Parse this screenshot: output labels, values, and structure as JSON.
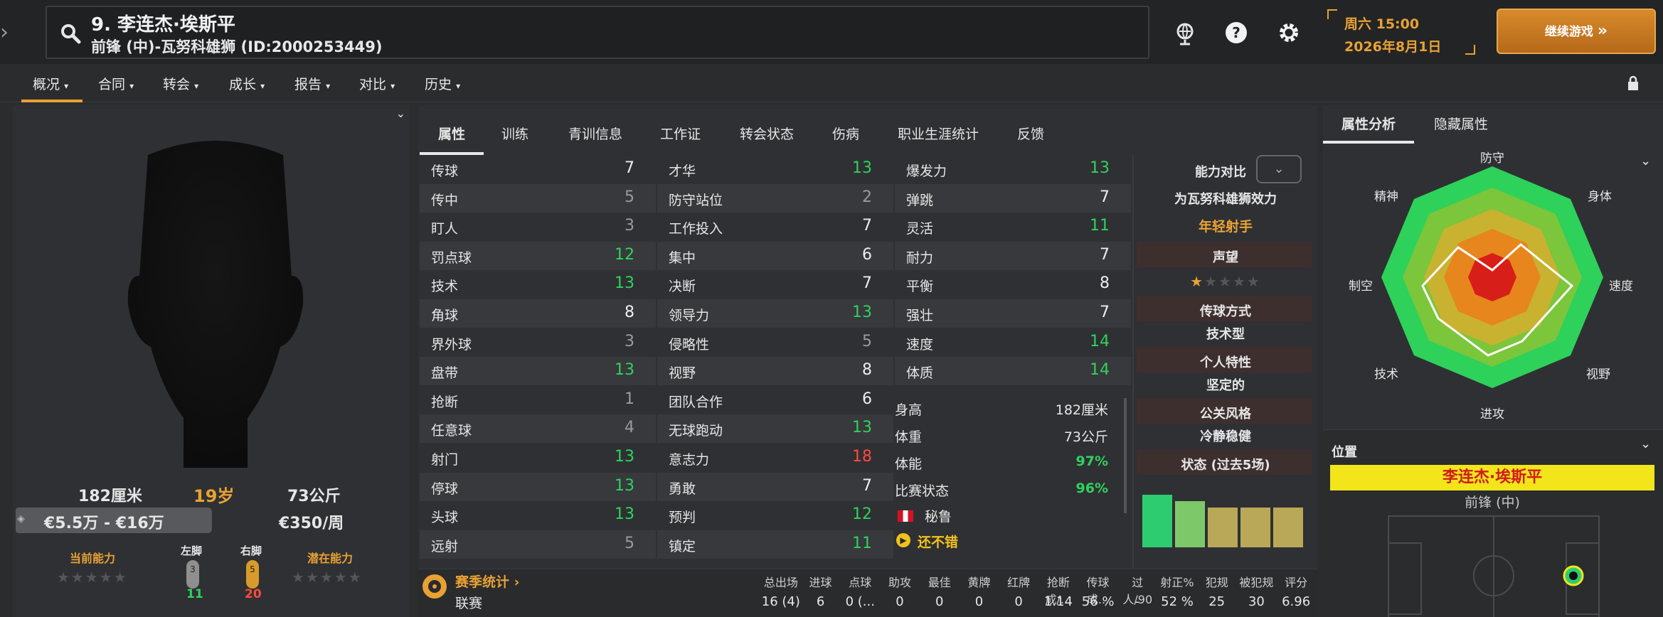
{
  "header": {
    "player_name": "9. 李连杰·埃斯平",
    "player_subtitle": "前锋 (中)-瓦努科雄狮 (ID:2000253449)",
    "date_weekday": "周六 15:00",
    "date_full": "2026年8月1日",
    "continue_label": "继续游戏"
  },
  "nav": {
    "items": [
      {
        "label": "概况"
      },
      {
        "label": "合同"
      },
      {
        "label": "转会"
      },
      {
        "label": "成长"
      },
      {
        "label": "报告"
      },
      {
        "label": "对比"
      },
      {
        "label": "历史"
      }
    ]
  },
  "player": {
    "height": "182厘米",
    "age": "19岁",
    "weight": "73公斤",
    "value": "€5.5万 - €16万",
    "wage": "€350/周",
    "current_ability_label": "当前能力",
    "potential_ability_label": "潜在能力",
    "left_foot_label": "左脚",
    "right_foot_label": "右脚",
    "left_foot_level": "3",
    "right_foot_level": "5",
    "left_foot_value": "11",
    "right_foot_value": "20"
  },
  "tabs": [
    "属性",
    "训练",
    "青训信息",
    "工作证",
    "转会状态",
    "伤病",
    "职业生涯统计",
    "反馈"
  ],
  "attributes": {
    "technical": [
      {
        "name": "传球",
        "value": "7"
      },
      {
        "name": "传中",
        "value": "5"
      },
      {
        "name": "盯人",
        "value": "3"
      },
      {
        "name": "罚点球",
        "value": "12"
      },
      {
        "name": "技术",
        "value": "13"
      },
      {
        "name": "角球",
        "value": "8"
      },
      {
        "name": "界外球",
        "value": "3"
      },
      {
        "name": "盘带",
        "value": "13"
      },
      {
        "name": "抢断",
        "value": "1"
      },
      {
        "name": "任意球",
        "value": "4"
      },
      {
        "name": "射门",
        "value": "13"
      },
      {
        "name": "停球",
        "value": "13"
      },
      {
        "name": "头球",
        "value": "13"
      },
      {
        "name": "远射",
        "value": "5"
      }
    ],
    "mental": [
      {
        "name": "才华",
        "value": "13"
      },
      {
        "name": "防守站位",
        "value": "2"
      },
      {
        "name": "工作投入",
        "value": "7"
      },
      {
        "name": "集中",
        "value": "6"
      },
      {
        "name": "决断",
        "value": "7"
      },
      {
        "name": "领导力",
        "value": "13"
      },
      {
        "name": "侵略性",
        "value": "5"
      },
      {
        "name": "视野",
        "value": "8"
      },
      {
        "name": "团队合作",
        "value": "6"
      },
      {
        "name": "无球跑动",
        "value": "13"
      },
      {
        "name": "意志力",
        "value": "18"
      },
      {
        "name": "勇敢",
        "value": "7"
      },
      {
        "name": "预判",
        "value": "12"
      },
      {
        "name": "镇定",
        "value": "11"
      }
    ],
    "physical": [
      {
        "name": "爆发力",
        "value": "13"
      },
      {
        "name": "弹跳",
        "value": "7"
      },
      {
        "name": "灵活",
        "value": "11"
      },
      {
        "name": "耐力",
        "value": "7"
      },
      {
        "name": "平衡",
        "value": "8"
      },
      {
        "name": "强壮",
        "value": "7"
      },
      {
        "name": "速度",
        "value": "14"
      },
      {
        "name": "体质",
        "value": "14"
      }
    ]
  },
  "body": {
    "height_label": "身高",
    "height_value": "182厘米",
    "weight_label": "体重",
    "weight_value": "73公斤",
    "fitness_label": "体能",
    "fitness_value": "97%",
    "match_label": "比赛状态",
    "match_value": "96%",
    "nation": "秘鲁",
    "morale": "还不错"
  },
  "comparison": {
    "title": "能力对比",
    "plays_for": "为瓦努科雄狮效力",
    "role": "年轻射手",
    "reputation_label": "声望",
    "pass_style_label": "传球方式",
    "pass_style_value": "技术型",
    "personality_label": "个人特性",
    "personality_value": "坚定的",
    "media_label": "公关风格",
    "media_value": "冷静稳健",
    "form_label": "状态 (过去5场)",
    "form": [
      0.82,
      0.72,
      0.62,
      0.62,
      0.62
    ],
    "form_colors": [
      "#2ecc71",
      "#7dc96a",
      "#b9a857",
      "#b9a857",
      "#b9a857"
    ]
  },
  "right": {
    "tab_analysis": "属性分析",
    "tab_hidden": "隐藏属性",
    "radar_labels": [
      "防守",
      "身体",
      "速度",
      "视野",
      "进攻",
      "技术",
      "制空",
      "精神"
    ],
    "position_title": "位置",
    "position_name": "李连杰·埃斯平",
    "position_role": "前锋 (中)"
  },
  "season": {
    "title": "赛季统计",
    "row_label": "联赛",
    "headers": [
      "总出场",
      "进球",
      "点球",
      "助攻",
      "最佳",
      "黄牌",
      "红牌",
      "抢断成/...",
      "传球成...",
      "过人/90",
      "射正%",
      "犯规",
      "被犯规",
      "评分"
    ],
    "values": [
      "16 (4)",
      "6",
      "0 (...",
      "0",
      "0",
      "0",
      "0",
      "1.14",
      "56 %",
      "-",
      "52 %",
      "25",
      "30",
      "6.96"
    ]
  },
  "colors": {
    "accent": "#e8a233",
    "green": "#2fd25e",
    "red": "#ff4a3d",
    "yellow_bar": "#f2e51a"
  }
}
